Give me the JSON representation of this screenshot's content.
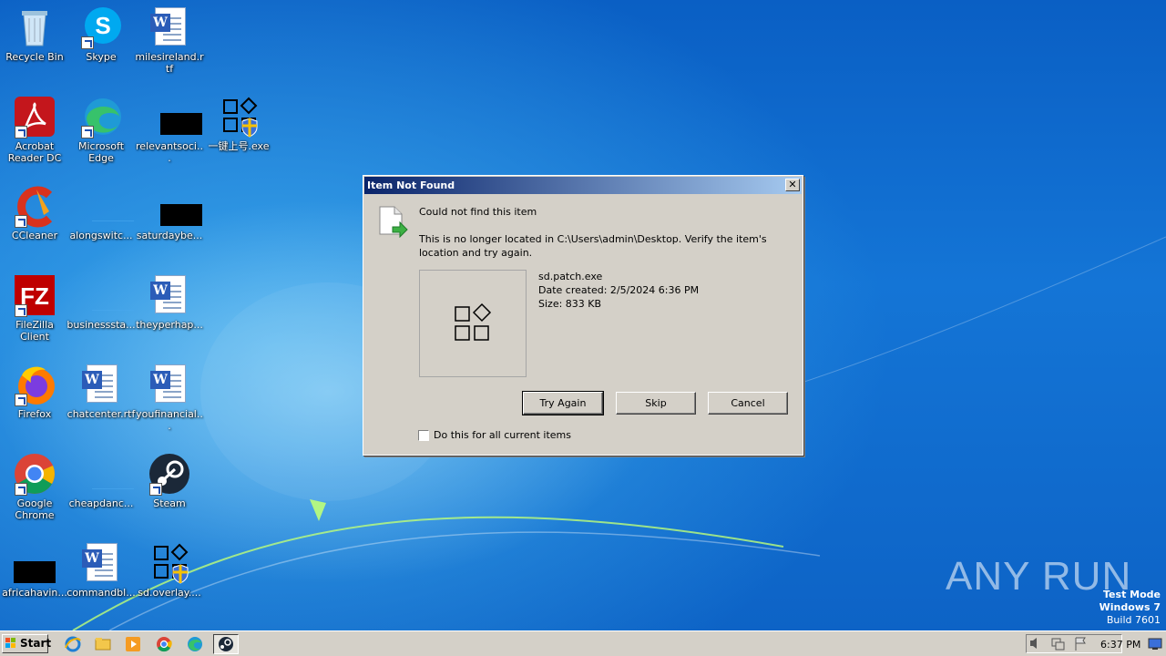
{
  "desktop": {
    "icons": [
      {
        "label": "Recycle Bin",
        "icon": "recycle-bin-icon"
      },
      {
        "label": "Skype",
        "icon": "skype-icon"
      },
      {
        "label": "milesireland.rtf",
        "icon": "word-document-icon"
      },
      {
        "label": "Acrobat Reader DC",
        "icon": "acrobat-icon"
      },
      {
        "label": "Microsoft Edge",
        "icon": "edge-icon"
      },
      {
        "label": "relevantsoci...",
        "icon": "redacted-file-icon"
      },
      {
        "label": "一键上号.exe",
        "icon": "exe-shield-icon"
      },
      {
        "label": "CCleaner",
        "icon": "ccleaner-icon"
      },
      {
        "label": "alongswitc...",
        "icon": "blank-file-icon"
      },
      {
        "label": "saturdaybe...",
        "icon": "redacted-file-icon"
      },
      {
        "label": "FileZilla Client",
        "icon": "filezilla-icon"
      },
      {
        "label": "businesssta...",
        "icon": "blank-file-icon"
      },
      {
        "label": "theyperhap...",
        "icon": "word-document-icon"
      },
      {
        "label": "Firefox",
        "icon": "firefox-icon"
      },
      {
        "label": "chatcenter.rtf",
        "icon": "word-document-icon"
      },
      {
        "label": "youfinancial...",
        "icon": "word-document-icon"
      },
      {
        "label": "Google Chrome",
        "icon": "chrome-icon"
      },
      {
        "label": "cheapdanc...",
        "icon": "blank-file-icon"
      },
      {
        "label": "Steam",
        "icon": "steam-icon"
      },
      {
        "label": "africahavin...",
        "icon": "redacted-file-icon"
      },
      {
        "label": "commandbl...",
        "icon": "word-document-icon"
      },
      {
        "label": "sd.overlay....",
        "icon": "exe-shield-icon"
      }
    ]
  },
  "dialog": {
    "title": "Item Not Found",
    "close_label": "✕",
    "heading": "Could not find this item",
    "message_line1": "This is no longer located in C:\\Users\\admin\\Desktop. Verify the item's",
    "message_line2": "location and try again.",
    "file_name": "sd.patch.exe",
    "date_created": "Date created: 2/5/2024 6:36 PM",
    "size": "Size: 833 KB",
    "buttons": {
      "try_again": "Try Again",
      "skip": "Skip",
      "cancel": "Cancel"
    },
    "checkbox_label": "Do this for all current items",
    "checkbox_checked": false
  },
  "watermark": {
    "line1": "Test Mode",
    "line2": "Windows 7",
    "line3": "Build 7601",
    "brand": "ANY RUN"
  },
  "taskbar": {
    "start_label": "Start",
    "pinned": [
      "internet-explorer-icon",
      "file-explorer-icon",
      "media-player-icon",
      "chrome-icon",
      "edge-icon",
      "steam-icon"
    ],
    "clock": "6:37 PM"
  }
}
